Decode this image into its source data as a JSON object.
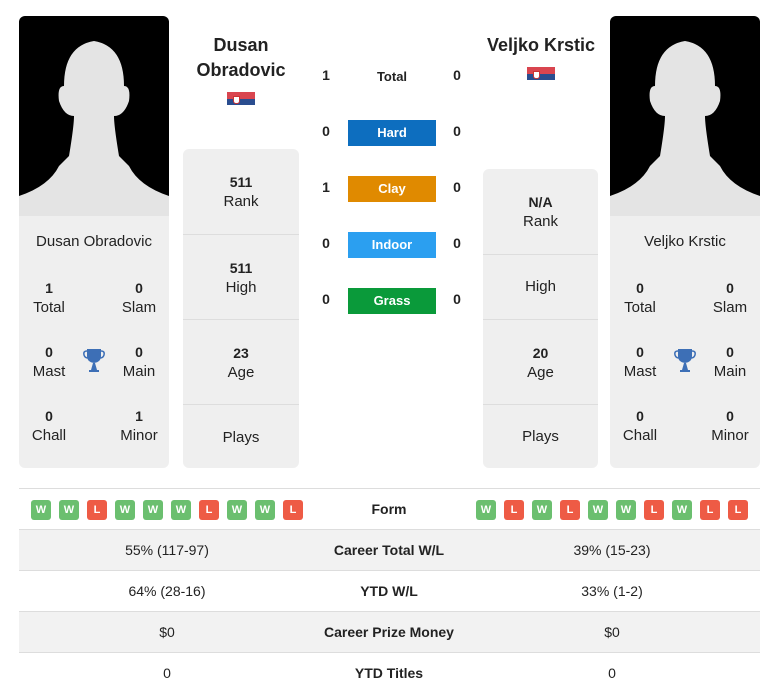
{
  "player1": {
    "name_line1": "Dusan",
    "name_line2": "Obradovic",
    "card_name": "Dusan Obradovic",
    "flag": "serbia-flag",
    "titles": {
      "total": "1",
      "total_label": "Total",
      "slam": "0",
      "slam_label": "Slam",
      "mast": "0",
      "mast_label": "Mast",
      "main": "0",
      "main_label": "Main",
      "chall": "0",
      "chall_label": "Chall",
      "minor": "1",
      "minor_label": "Minor"
    },
    "rank": "511",
    "rank_label": "Rank",
    "high": "511",
    "high_label": "High",
    "age": "23",
    "age_label": "Age",
    "plays": "",
    "plays_label": "Plays",
    "form": [
      "W",
      "W",
      "L",
      "W",
      "W",
      "W",
      "L",
      "W",
      "W",
      "L"
    ]
  },
  "player2": {
    "name": "Veljko Krstic",
    "card_name": "Veljko Krstic",
    "flag": "serbia-flag",
    "titles": {
      "total": "0",
      "total_label": "Total",
      "slam": "0",
      "slam_label": "Slam",
      "mast": "0",
      "mast_label": "Mast",
      "main": "0",
      "main_label": "Main",
      "chall": "0",
      "chall_label": "Chall",
      "minor": "0",
      "minor_label": "Minor"
    },
    "rank": "N/A",
    "rank_label": "Rank",
    "high": "",
    "high_label": "High",
    "age": "20",
    "age_label": "Age",
    "plays": "",
    "plays_label": "Plays",
    "form": [
      "W",
      "L",
      "W",
      "L",
      "W",
      "W",
      "L",
      "W",
      "L",
      "L"
    ]
  },
  "h2h": [
    {
      "label": "Total",
      "p1": "1",
      "p2": "0",
      "color": ""
    },
    {
      "label": "Hard",
      "p1": "0",
      "p2": "0",
      "color": "#0d6ebf"
    },
    {
      "label": "Clay",
      "p1": "1",
      "p2": "0",
      "color": "#e08a00"
    },
    {
      "label": "Indoor",
      "p1": "0",
      "p2": "0",
      "color": "#2b9ff0"
    },
    {
      "label": "Grass",
      "p1": "0",
      "p2": "0",
      "color": "#0a9a3a"
    }
  ],
  "comparison": {
    "form_label": "Form",
    "rows": [
      {
        "label": "Career Total W/L",
        "p1": "55% (117-97)",
        "p2": "39% (15-23)"
      },
      {
        "label": "YTD W/L",
        "p1": "64% (28-16)",
        "p2": "33% (1-2)"
      },
      {
        "label": "Career Prize Money",
        "p1": "$0",
        "p2": "$0"
      },
      {
        "label": "YTD Titles",
        "p1": "0",
        "p2": "0"
      }
    ]
  },
  "icons": {
    "trophy": "trophy-icon",
    "avatar": "player-silhouette"
  }
}
